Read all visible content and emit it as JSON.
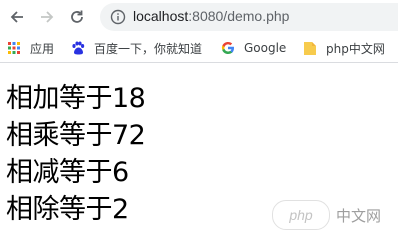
{
  "toolbar": {
    "url_host": "localhost",
    "url_rest": ":8080/demo.php"
  },
  "bookmarks": [
    {
      "label": "应用",
      "icon": "apps-grid-icon"
    },
    {
      "label": "百度一下，你就知道",
      "icon": "baidu-paw-icon"
    },
    {
      "label": "Google",
      "icon": "google-g-icon"
    },
    {
      "label": "php中文网",
      "icon": "folder-icon"
    }
  ],
  "content": {
    "lines": [
      "相加等于18",
      "相乘等于72",
      "相减等于6",
      "相除等于2"
    ]
  },
  "watermark": {
    "logo_text": "php",
    "text": "中文网"
  },
  "colors": {
    "omnibox_bg": "#f1f3f4",
    "google_blue": "#4285f4",
    "google_red": "#ea4335",
    "google_yellow": "#fbbc05",
    "google_green": "#34a853",
    "folder_yellow": "#f7cb4d"
  }
}
